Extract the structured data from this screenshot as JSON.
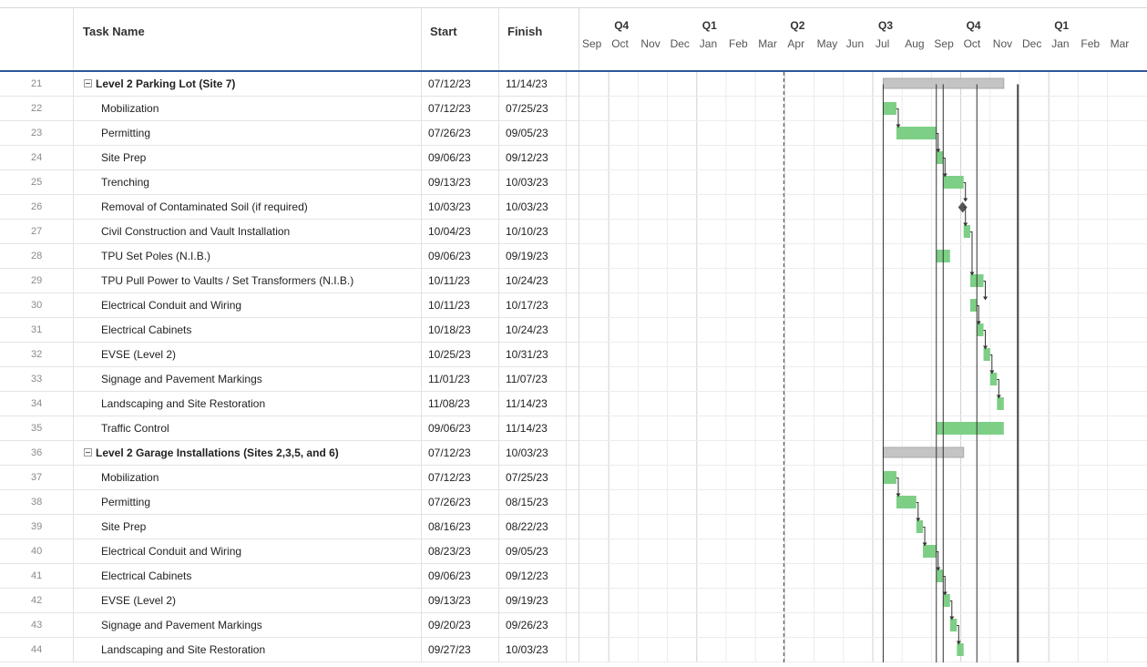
{
  "columns": {
    "task": "Task Name",
    "start": "Start",
    "finish": "Finish"
  },
  "timeline": {
    "quarters": [
      "Q4",
      "Q1",
      "Q2",
      "Q3",
      "Q4",
      "Q1"
    ],
    "months": [
      "Sep",
      "Oct",
      "Nov",
      "Dec",
      "Jan",
      "Feb",
      "Mar",
      "Apr",
      "May",
      "Jun",
      "Jul",
      "Aug",
      "Sep",
      "Oct",
      "Nov",
      "Dec",
      "Jan",
      "Feb",
      "Mar"
    ],
    "month_starts": [
      "2022-09-01",
      "2022-10-01",
      "2022-11-01",
      "2022-12-01",
      "2023-01-01",
      "2023-02-01",
      "2023-03-01",
      "2023-04-01",
      "2023-05-01",
      "2023-06-01",
      "2023-07-01",
      "2023-08-01",
      "2023-09-01",
      "2023-10-01",
      "2023-11-01",
      "2023-12-01",
      "2024-01-01",
      "2024-02-01",
      "2024-03-01"
    ],
    "today": "2023-03-31",
    "colors": {
      "bar": "#7dcf85",
      "summary_bar": "#c4c4c4",
      "milestone": "#555555",
      "header_line": "#2b579a"
    }
  },
  "rows": [
    {
      "num": "21",
      "task": "Level 2 Parking Lot (Site 7)",
      "start": "07/12/23",
      "finish": "11/14/23",
      "summary": true
    },
    {
      "num": "22",
      "task": "Mobilization",
      "start": "07/12/23",
      "finish": "07/25/23"
    },
    {
      "num": "23",
      "task": "Permitting",
      "start": "07/26/23",
      "finish": "09/05/23"
    },
    {
      "num": "24",
      "task": "Site Prep",
      "start": "09/06/23",
      "finish": "09/12/23"
    },
    {
      "num": "25",
      "task": "Trenching",
      "start": "09/13/23",
      "finish": "10/03/23"
    },
    {
      "num": "26",
      "task": "Removal of Contaminated Soil (if required)",
      "start": "10/03/23",
      "finish": "10/03/23",
      "milestone": true
    },
    {
      "num": "27",
      "task": "Civil Construction and Vault Installation",
      "start": "10/04/23",
      "finish": "10/10/23"
    },
    {
      "num": "28",
      "task": "TPU Set Poles (N.I.B.)",
      "start": "09/06/23",
      "finish": "09/19/23"
    },
    {
      "num": "29",
      "task": "TPU Pull Power to Vaults / Set Transformers (N.I.B.)",
      "start": "10/11/23",
      "finish": "10/24/23"
    },
    {
      "num": "30",
      "task": "Electrical Conduit and Wiring",
      "start": "10/11/23",
      "finish": "10/17/23"
    },
    {
      "num": "31",
      "task": "Electrical Cabinets",
      "start": "10/18/23",
      "finish": "10/24/23"
    },
    {
      "num": "32",
      "task": "EVSE (Level 2)",
      "start": "10/25/23",
      "finish": "10/31/23"
    },
    {
      "num": "33",
      "task": "Signage and Pavement Markings",
      "start": "11/01/23",
      "finish": "11/07/23"
    },
    {
      "num": "34",
      "task": "Landscaping and Site Restoration",
      "start": "11/08/23",
      "finish": "11/14/23"
    },
    {
      "num": "35",
      "task": "Traffic Control",
      "start": "09/06/23",
      "finish": "11/14/23"
    },
    {
      "num": "36",
      "task": "Level 2 Garage Installations (Sites 2,3,5, and 6)",
      "start": "07/12/23",
      "finish": "10/03/23",
      "summary": true
    },
    {
      "num": "37",
      "task": "Mobilization",
      "start": "07/12/23",
      "finish": "07/25/23"
    },
    {
      "num": "38",
      "task": "Permitting",
      "start": "07/26/23",
      "finish": "08/15/23"
    },
    {
      "num": "39",
      "task": "Site Prep",
      "start": "08/16/23",
      "finish": "08/22/23"
    },
    {
      "num": "40",
      "task": "Electrical Conduit and Wiring",
      "start": "08/23/23",
      "finish": "09/05/23"
    },
    {
      "num": "41",
      "task": "Electrical Cabinets",
      "start": "09/06/23",
      "finish": "09/12/23"
    },
    {
      "num": "42",
      "task": "EVSE (Level 2)",
      "start": "09/13/23",
      "finish": "09/19/23"
    },
    {
      "num": "43",
      "task": "Signage and Pavement Markings",
      "start": "09/20/23",
      "finish": "09/26/23"
    },
    {
      "num": "44",
      "task": "Landscaping and Site Restoration",
      "start": "09/27/23",
      "finish": "10/03/23"
    }
  ]
}
